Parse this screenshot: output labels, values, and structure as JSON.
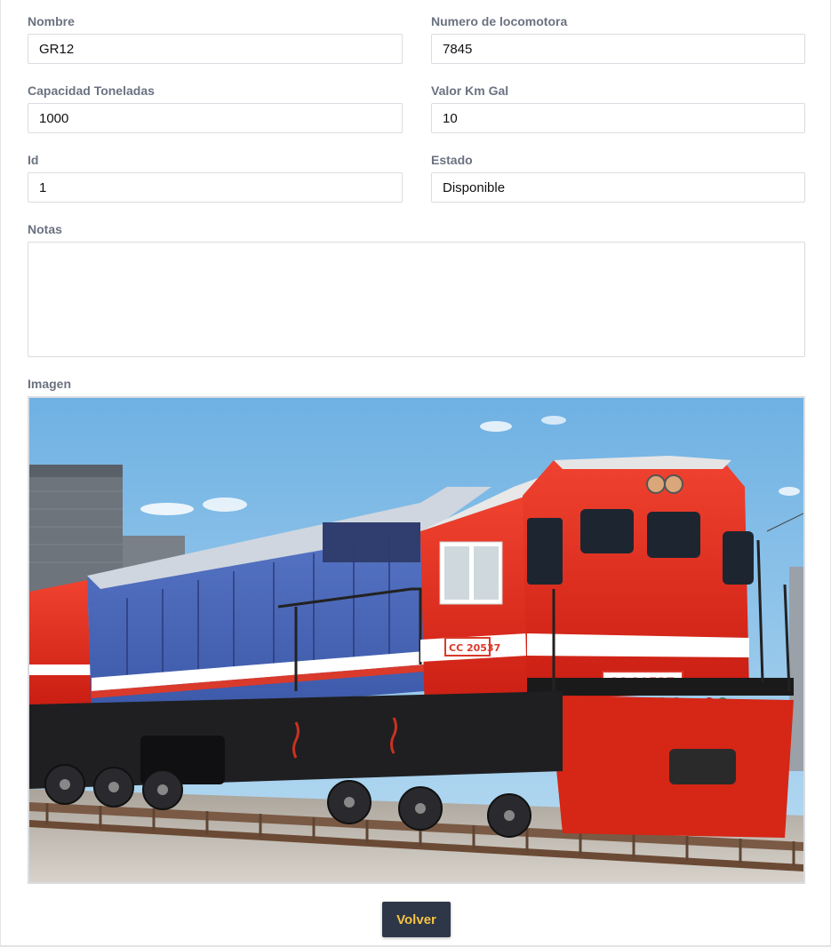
{
  "form": {
    "nombre": {
      "label": "Nombre",
      "value": "GR12"
    },
    "numero": {
      "label": "Numero de locomotora",
      "value": "7845"
    },
    "capacidad": {
      "label": "Capacidad Toneladas",
      "value": "1000"
    },
    "valor": {
      "label": "Valor Km Gal",
      "value": "10"
    },
    "id": {
      "label": "Id",
      "value": "1"
    },
    "estado": {
      "label": "Estado",
      "value": "Disponible"
    },
    "notas": {
      "label": "Notas",
      "value": ""
    },
    "imagen": {
      "label": "Imagen",
      "plate_text": "CC 20537"
    }
  },
  "actions": {
    "volver_label": "Volver"
  },
  "colors": {
    "button_bg": "#2d3748",
    "button_text": "#f6c343",
    "label": "#6b7280"
  }
}
